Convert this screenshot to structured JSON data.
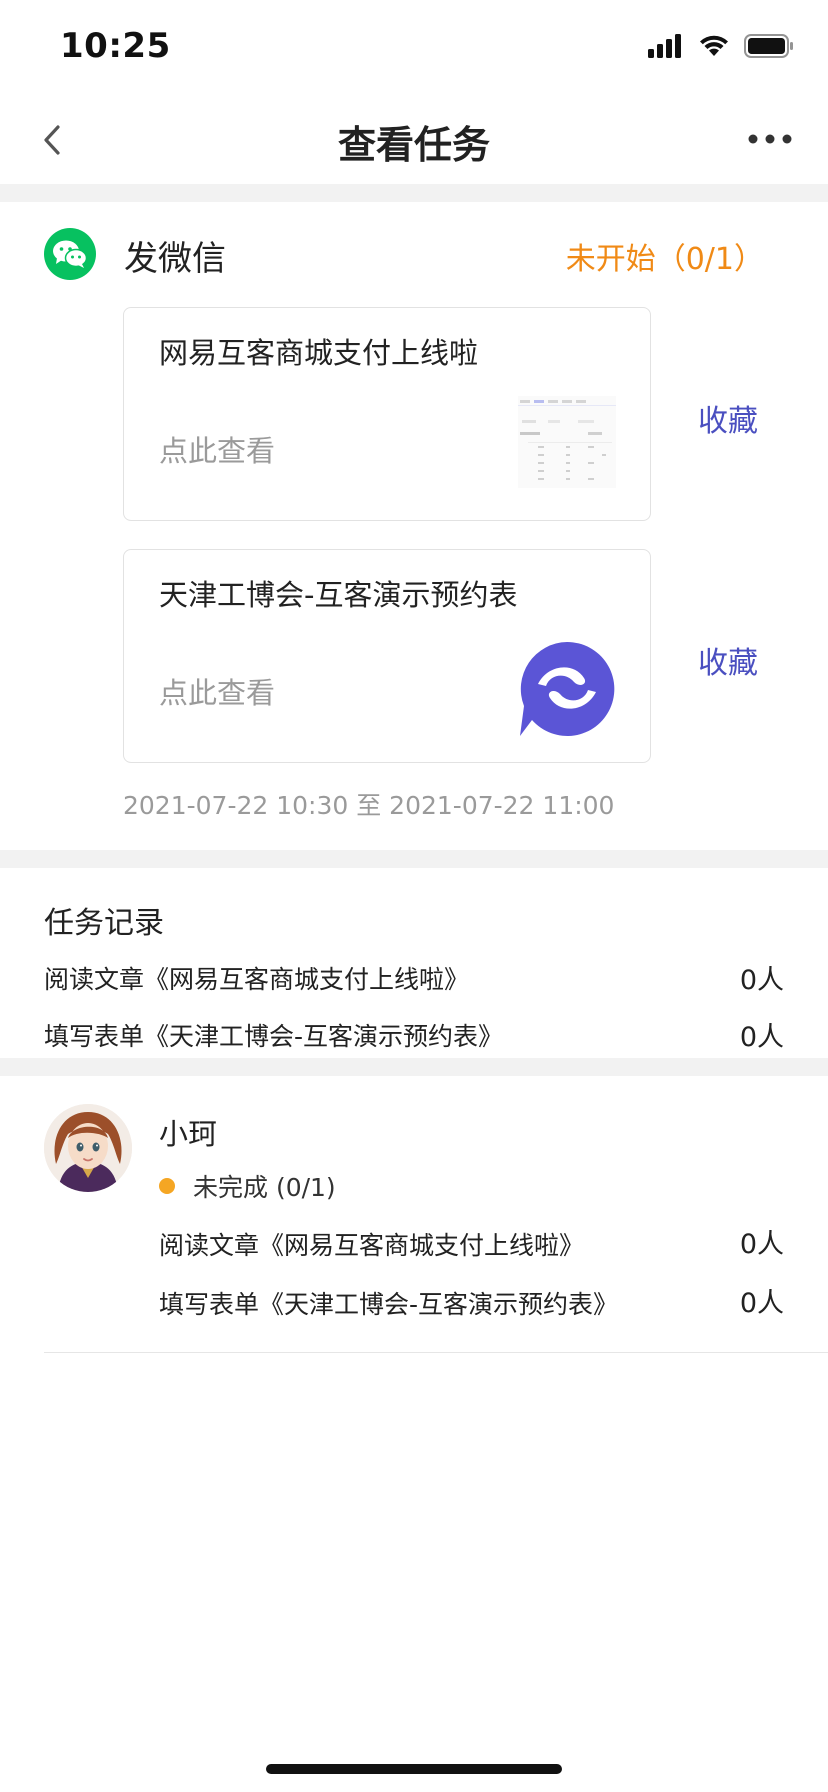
{
  "status_bar": {
    "time": "10:25"
  },
  "nav": {
    "title": "查看任务"
  },
  "task": {
    "type": "发微信",
    "status": "未开始（0/1）",
    "cards": [
      {
        "title": "网易互客商城支付上线啦",
        "link": "点此查看",
        "fav": "收藏",
        "thumb": "doc-screenshot"
      },
      {
        "title": "天津工博会-互客演示预约表",
        "link": "点此查看",
        "fav": "收藏",
        "thumb": "app-logo-icon"
      }
    ],
    "time_range": "2021-07-22 10:30 至 2021-07-22 11:00"
  },
  "records": {
    "title": "任务记录",
    "rows": [
      {
        "label": "阅读文章《网易互客商城支付上线啦》",
        "count": "0人"
      },
      {
        "label": "填写表单《天津工博会-互客演示预约表》",
        "count": "0人"
      }
    ]
  },
  "user": {
    "name": "小珂",
    "status": "未完成 (0/1)",
    "rows": [
      {
        "label": "阅读文章《网易互客商城支付上线啦》",
        "count": "0人"
      },
      {
        "label": "填写表单《天津工博会-互客演示预约表》",
        "count": "0人"
      }
    ]
  },
  "colors": {
    "wechat_green": "#07c160",
    "status_orange": "#f08a16",
    "fav_blue": "#4a4fc0",
    "logo_purple": "#5b55d6",
    "dot_orange": "#f5a623"
  }
}
